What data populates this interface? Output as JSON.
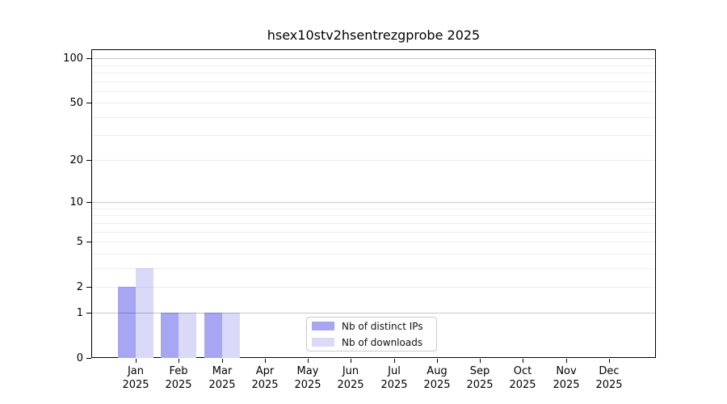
{
  "title": "hsex10stv2hsentrezgprobe 2025",
  "chart_data": {
    "type": "bar",
    "title": "hsex10stv2hsentrezgprobe 2025",
    "xlabel": "",
    "ylabel": "",
    "year": "2025",
    "categories": [
      "Jan 2025",
      "Feb 2025",
      "Mar 2025",
      "Apr 2025",
      "May 2025",
      "Jun 2025",
      "Jul 2025",
      "Aug 2025",
      "Sep 2025",
      "Oct 2025",
      "Nov 2025",
      "Dec 2025"
    ],
    "months": [
      "Jan",
      "Feb",
      "Mar",
      "Apr",
      "May",
      "Jun",
      "Jul",
      "Aug",
      "Sep",
      "Oct",
      "Nov",
      "Dec"
    ],
    "series": [
      {
        "name": "Nb of distinct IPs",
        "color": "#a6a6f2",
        "values": [
          2,
          1,
          1,
          0,
          0,
          0,
          0,
          0,
          0,
          0,
          0,
          0
        ]
      },
      {
        "name": "Nb of downloads",
        "color": "#dadaf8",
        "values": [
          3,
          1,
          1,
          0,
          0,
          0,
          0,
          0,
          0,
          0,
          0,
          0
        ]
      }
    ],
    "y_axis": {
      "scale": "log10(1+value)",
      "ticks": [
        0,
        1,
        2,
        5,
        10,
        20,
        50,
        100
      ],
      "minor_gridlines": [
        3,
        4,
        6,
        7,
        8,
        9,
        30,
        40,
        60,
        70,
        80,
        90
      ],
      "major_gridlines": [
        1,
        10,
        100
      ],
      "range_top": 115
    },
    "grid": "horizontal",
    "legend_position": "lower center",
    "background_color": "#ffffff",
    "axis_color": "#000000"
  },
  "legend": {
    "items": [
      {
        "label": "Nb of distinct IPs",
        "color": "#a6a6f2"
      },
      {
        "label": "Nb of downloads",
        "color": "#dadaf8"
      }
    ]
  }
}
